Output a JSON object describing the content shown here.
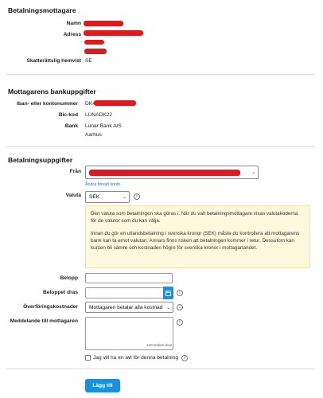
{
  "recipient": {
    "heading": "Betalningsmottagare",
    "name_label": "Namn",
    "address_label": "Adress",
    "residence_label": "Skatterättslig hemvist",
    "residence_value": "SE"
  },
  "bank": {
    "heading": "Mottagarens bankuppgifter",
    "iban_label": "Iban- eller kontonummer",
    "iban_prefix": "DK49",
    "bic_label": "Bic-kod",
    "bic_value": "LUNADK22",
    "bank_label": "Bank",
    "bank_name": "Lunar Bank A/S",
    "bank_city": "Aarhus"
  },
  "payment": {
    "heading": "Betalningsuppgifter",
    "from_label": "Från",
    "change_account_link": "Ändra förvalt konto",
    "currency_label": "Valuta",
    "currency_value": "SEK",
    "notice_p1": "Den valuta som betalningen ska göras i. När du valt betalningsmottagare visas valutakoderna för de valutor som du kan välja.",
    "notice_p2": "Innan du gör en utlandsbetalning i svenska kronor (SEK) måste du kontrollera att mottagarens bank kan ta emot valutan. Annars finns risken att betalningen kommer i retur. Dessutom kan kursen bli sämre och kostnaden högre för svenska kronor i mottagarlandet.",
    "amount_label": "Belopp",
    "amount_value": "",
    "date_label": "Beloppet dras",
    "date_value": "",
    "fees_label": "Överföringskostnader",
    "fees_value": "Mottagaren betalar alla kostnad",
    "message_label": "Meddelande till mottagaren",
    "message_value": "",
    "char_counter": "140 tecken kvar",
    "notify_label": "Jag vill ha en avi för denna betalning",
    "submit_label": "Lägg till"
  },
  "colors": {
    "redaction": "#e0191e",
    "accent": "#1b8fe0",
    "notice_bg": "#fff8dc"
  },
  "icons": {
    "info": "info-icon",
    "calendar": "calendar-icon",
    "chevron": "chevron-down-icon"
  }
}
